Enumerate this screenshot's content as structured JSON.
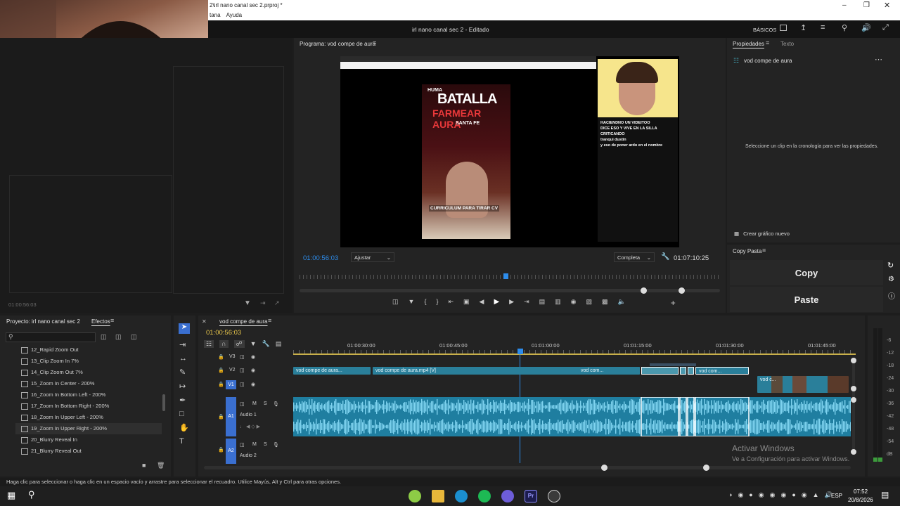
{
  "window": {
    "title": "2\\irl nano canal sec 2.prproj *",
    "menu": [
      "tana",
      "Ayuda"
    ],
    "document_title": "irl nano canal sec 2 - Editado",
    "workspace": "BÁSICOS"
  },
  "program_monitor": {
    "title": "Programa: vod compe de aura",
    "timecode": "01:00:56:03",
    "fit": "Ajustar",
    "quality": "Completa",
    "duration": "01:07:10:25",
    "video_texts": {
      "headline1": "BATALLA",
      "headline2": "FARMEAR AURA",
      "location": "SANTA FE",
      "caption": "CURRICULUM PARA TIRAR CV",
      "chat_line1": "HACIENDNO UN VIDEITOO",
      "chat_line2": "DICE ESO Y VIVE EN LA SILLA CRITICANDO",
      "chat_line3": "tranqui dustin",
      "chat_line4": "y eso de poner ardo en el nombre"
    }
  },
  "source_panel": {
    "timecode": "01:00:56:03"
  },
  "properties": {
    "tabs": [
      "Propiedades",
      "Texto"
    ],
    "item": "vod compe de aura",
    "empty_message": "Seleccione un clip en la cronología para ver las propiedades.",
    "create_button": "Crear gráfico nuevo"
  },
  "copy_paste": {
    "title": "Copy Pasta",
    "copy": "Copy",
    "paste": "Paste"
  },
  "project": {
    "title": "Proyecto: irl nano canal sec 2",
    "effects_tab": "Efectos",
    "items": [
      "12_Rapid Zoom Out",
      "13_Clip Zoom In 7%",
      "14_Clip Zoom Out 7%",
      "15_Zoom In Center - 200%",
      "16_Zoom In Bottom Left - 200%",
      "17_Zoom In Bottom Right - 200%",
      "18_Zoom In Upper Left - 200%",
      "19_Zoom In Upper Right - 200%",
      "20_Blurry Reveal In",
      "21_Blurry Reveal Out"
    ]
  },
  "timeline": {
    "title": "vod compe de aura",
    "timecode": "01:00:56:03",
    "ruler": [
      "01:00:30:00",
      "01:00:45:00",
      "01:01:00:00",
      "01:01:15:00",
      "01:01:30:00",
      "01:01:45:00"
    ],
    "tracks": {
      "v3": "V3",
      "v2": "V2",
      "v1": "V1",
      "a1": "A1",
      "a2": "A2",
      "audio1": "Audio 1",
      "audio2": "Audio 2",
      "m": "M",
      "s": "S"
    },
    "clips": {
      "c1": "vod compe de aura...",
      "c2": "vod compe de aura.mp4 [V]",
      "c3": "vod com...",
      "c4": "vod com...",
      "c5": "vod c..."
    },
    "meter": [
      "-6",
      "-12",
      "-18",
      "-24",
      "-30",
      "-36",
      "-42",
      "-48",
      "-54",
      "dB"
    ]
  },
  "watermark": {
    "line1": "Activar Windows",
    "line2": "Ve a Configuración para activar Windows."
  },
  "status_bar": "Haga clic para seleccionar o haga clic en un espacio vacío y arrastre para seleccionar el recuadro. Utilice Mayús, Alt y Ctrl para otras opciones.",
  "taskbar": {
    "lang": "ESP",
    "time": "07:52",
    "date": "20/8/2026"
  }
}
